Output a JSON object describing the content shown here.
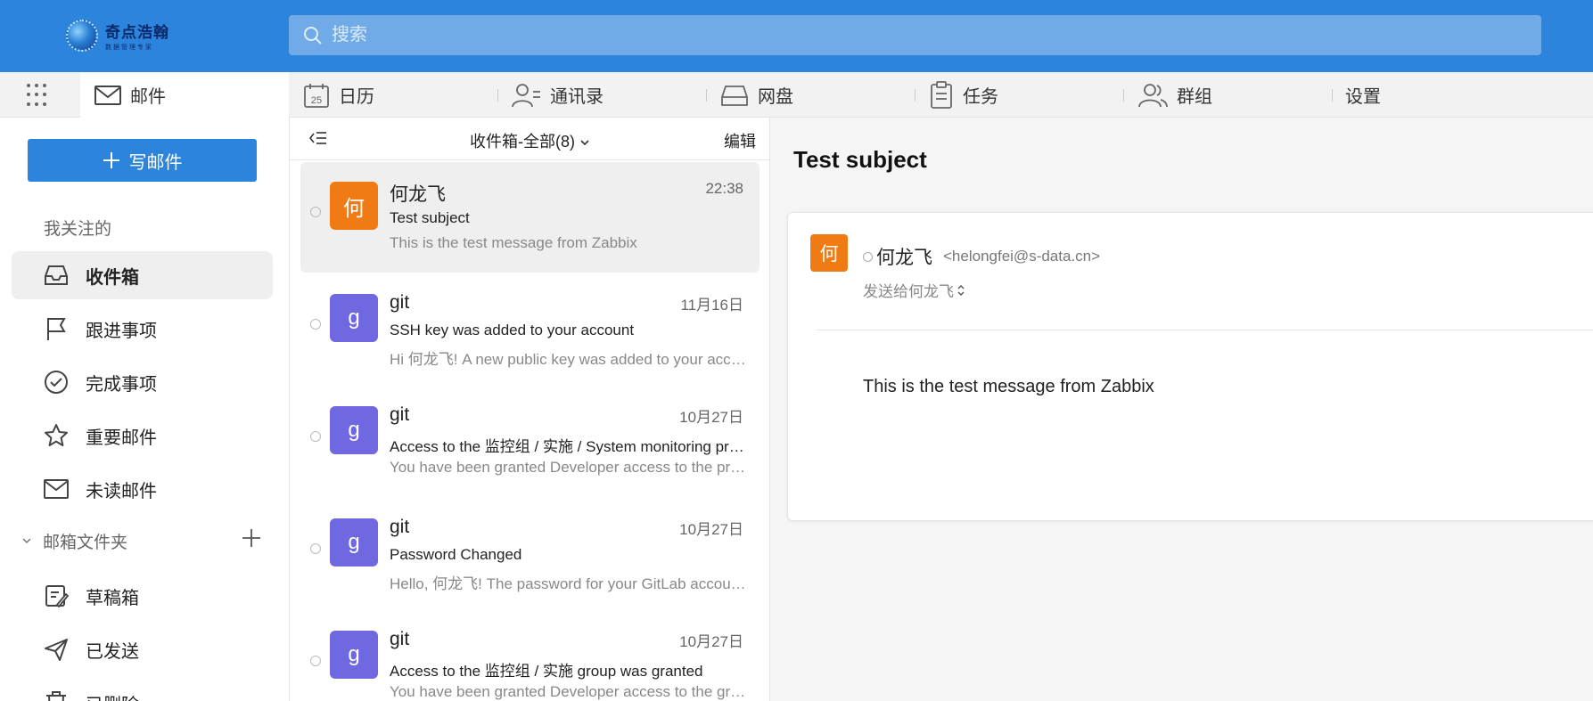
{
  "header": {
    "logo_main": "奇点浩翰",
    "logo_sub": "数据管理专家",
    "search_placeholder": "搜索"
  },
  "nav": {
    "mail": "邮件",
    "calendar": "日历",
    "calendar_day": "25",
    "contacts": "通讯录",
    "drive": "网盘",
    "tasks": "任务",
    "groups": "群组",
    "settings": "设置"
  },
  "sidebar": {
    "compose_label": "写邮件",
    "favorites_label": "我关注的",
    "favorites": [
      {
        "label": "收件箱",
        "icon": "inbox-icon"
      },
      {
        "label": "跟进事项",
        "icon": "flag-icon"
      },
      {
        "label": "完成事项",
        "icon": "check-circle-icon"
      },
      {
        "label": "重要邮件",
        "icon": "star-icon"
      },
      {
        "label": "未读邮件",
        "icon": "envelope-icon"
      }
    ],
    "folders_label": "邮箱文件夹",
    "folders": [
      {
        "label": "草稿箱",
        "icon": "draft-icon"
      },
      {
        "label": "已发送",
        "icon": "send-icon"
      },
      {
        "label": "已删除",
        "icon": "trash-icon"
      }
    ]
  },
  "list": {
    "title": "收件箱-全部",
    "count": "(8)",
    "edit_label": "编辑",
    "messages": [
      {
        "avatar": "何",
        "avatar_color": "#f07a14",
        "sender": "何龙飞",
        "time": "22:38",
        "subject": "Test subject",
        "preview": "This is the test message from Zabbix"
      },
      {
        "avatar": "g",
        "avatar_color": "#7068e0",
        "sender": "git",
        "time": "11月16日",
        "subject": "SSH key was added to your account",
        "preview": "Hi 何龙飞! A new public key was added to your account"
      },
      {
        "avatar": "g",
        "avatar_color": "#7068e0",
        "sender": "git",
        "time": "10月27日",
        "subject": "Access to the 监控组 / 实施 / System monitoring project was granted",
        "preview": "You have been granted Developer access to the project"
      },
      {
        "avatar": "g",
        "avatar_color": "#7068e0",
        "sender": "git",
        "time": "10月27日",
        "subject": "Password Changed",
        "preview": "Hello, 何龙飞! The password for your GitLab account has been changed"
      },
      {
        "avatar": "g",
        "avatar_color": "#7068e0",
        "sender": "git",
        "time": "10月27日",
        "subject": "Access to the 监控组 / 实施 group was granted",
        "preview": "You have been granted Developer access to the group"
      }
    ]
  },
  "reader": {
    "subject": "Test subject",
    "avatar": "何",
    "from_name": "何龙飞",
    "from_addr": "<helongfei@s-data.cn>",
    "to_line": "发送给何龙飞",
    "body": "This is the test message from Zabbix"
  },
  "colors": {
    "brand": "#2d84dd",
    "orange_avatar": "#f07a14",
    "purple_avatar": "#7068e0"
  }
}
